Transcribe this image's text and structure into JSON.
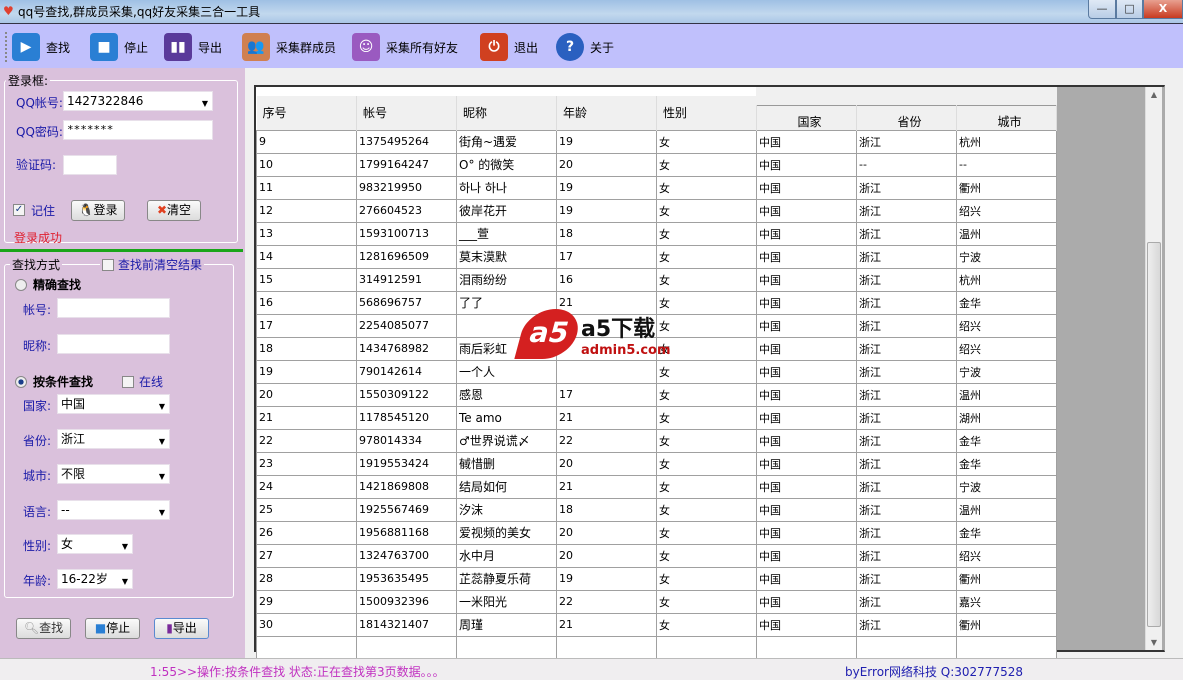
{
  "window": {
    "title": "qq号查找,群成员采集,qq好友采集三合一工具",
    "min": "—",
    "max": "□",
    "close": "X"
  },
  "toolbar": [
    {
      "label": "查找",
      "icon": "play-icon",
      "color": "#2a7fd4"
    },
    {
      "label": "停止",
      "icon": "stop-icon",
      "color": "#2a7fd4"
    },
    {
      "label": "导出",
      "icon": "bar-chart-icon",
      "color": "#5a3a9a"
    },
    {
      "label": "采集群成员",
      "icon": "users-icon",
      "color": "#d08050"
    },
    {
      "label": "采集所有好友",
      "icon": "girl-avatar-icon",
      "color": "#9a5ac0"
    },
    {
      "label": "退出",
      "icon": "power-icon",
      "color": "#d04020"
    },
    {
      "label": "关于",
      "icon": "help-icon",
      "color": "#2a60c0"
    }
  ],
  "login": {
    "group_title": "登录框:",
    "qq_label": "QQ帐号:",
    "qq_value": "1427322846",
    "pwd_label": "QQ密码:",
    "pwd_value": "*******",
    "captcha_label": "验证码:",
    "captcha_value": "",
    "remember_label": "记住",
    "remember_checked": true,
    "login_btn": "登录",
    "clear_btn": "清空",
    "status": "登录成功"
  },
  "search": {
    "group_title": "查找方式",
    "clear_before_label": "查找前清空结果",
    "exact_label": "精确查找",
    "account_label": "帐号:",
    "nick_label": "昵称:",
    "cond_label": "按条件查找",
    "online_label": "在线",
    "fields": [
      {
        "label": "国家:",
        "value": "中国"
      },
      {
        "label": "省份:",
        "value": "浙江"
      },
      {
        "label": "城市:",
        "value": "不限"
      },
      {
        "label": "语言:",
        "value": "--"
      },
      {
        "label": "性别:",
        "value": "女"
      },
      {
        "label": "年龄:",
        "value": "16-22岁"
      }
    ],
    "find_btn": "查找",
    "stop_btn": "停止",
    "export_btn": "导出"
  },
  "table": {
    "headers": [
      "序号",
      "帐号",
      "昵称",
      "年龄",
      "性别",
      "国家",
      "省份",
      "城市"
    ],
    "rows": [
      [
        "9",
        "1375495264",
        "街角~遇爱",
        "19",
        "女",
        "中国",
        "浙江",
        "杭州"
      ],
      [
        "10",
        "1799164247",
        "O° 的微笑",
        "20",
        "女",
        "中国",
        "--",
        "--"
      ],
      [
        "11",
        "983219950",
        "하나 하나",
        "19",
        "女",
        "中国",
        "浙江",
        "衢州"
      ],
      [
        "12",
        "276604523",
        "彼岸花开",
        "19",
        "女",
        "中国",
        "浙江",
        "绍兴"
      ],
      [
        "13",
        "1593100713",
        "___萱",
        "18",
        "女",
        "中国",
        "浙江",
        "温州"
      ],
      [
        "14",
        "1281696509",
        "莫末漠默",
        "17",
        "女",
        "中国",
        "浙江",
        "宁波"
      ],
      [
        "15",
        "314912591",
        "泪雨纷纷",
        "16",
        "女",
        "中国",
        "浙江",
        "杭州"
      ],
      [
        "16",
        "568696757",
        "了了",
        "21",
        "女",
        "中国",
        "浙江",
        "金华"
      ],
      [
        "17",
        "2254085077",
        "",
        "",
        "女",
        "中国",
        "浙江",
        "绍兴"
      ],
      [
        "18",
        "1434768982",
        "雨后彩虹",
        "",
        "女",
        "中国",
        "浙江",
        "绍兴"
      ],
      [
        "19",
        "790142614",
        "一个人",
        "",
        "女",
        "中国",
        "浙江",
        "宁波"
      ],
      [
        "20",
        "1550309122",
        "感恩",
        "17",
        "女",
        "中国",
        "浙江",
        "温州"
      ],
      [
        "21",
        "1178545120",
        "Te amo",
        "21",
        "女",
        "中国",
        "浙江",
        "湖州"
      ],
      [
        "22",
        "978014334",
        "♂世界说谎〆",
        "22",
        "女",
        "中国",
        "浙江",
        "金华"
      ],
      [
        "23",
        "1919553424",
        "戫惜删",
        "20",
        "女",
        "中国",
        "浙江",
        "金华"
      ],
      [
        "24",
        "1421869808",
        "结局如何",
        "21",
        "女",
        "中国",
        "浙江",
        "宁波"
      ],
      [
        "25",
        "1925567469",
        "汐沫",
        "18",
        "女",
        "中国",
        "浙江",
        "温州"
      ],
      [
        "26",
        "1956881168",
        "爱视频的美女",
        "20",
        "女",
        "中国",
        "浙江",
        "金华"
      ],
      [
        "27",
        "1324763700",
        "水中月",
        "20",
        "女",
        "中国",
        "浙江",
        "绍兴"
      ],
      [
        "28",
        "1953635495",
        "芷蕊静夏乐荷",
        "19",
        "女",
        "中国",
        "浙江",
        "衢州"
      ],
      [
        "29",
        "1500932396",
        "一米阳光",
        "22",
        "女",
        "中国",
        "浙江",
        "嘉兴"
      ],
      [
        "30",
        "1814321407",
        "周瑾",
        "21",
        "女",
        "中国",
        "浙江",
        "衢州"
      ]
    ]
  },
  "watermark": {
    "logo": "a5下载",
    "url": "admin5.com"
  },
  "status": {
    "left": "1:55>>操作:按条件查找 状态:正在查找第3页数据。。。",
    "right": "byError网络科技 Q:302777528"
  }
}
